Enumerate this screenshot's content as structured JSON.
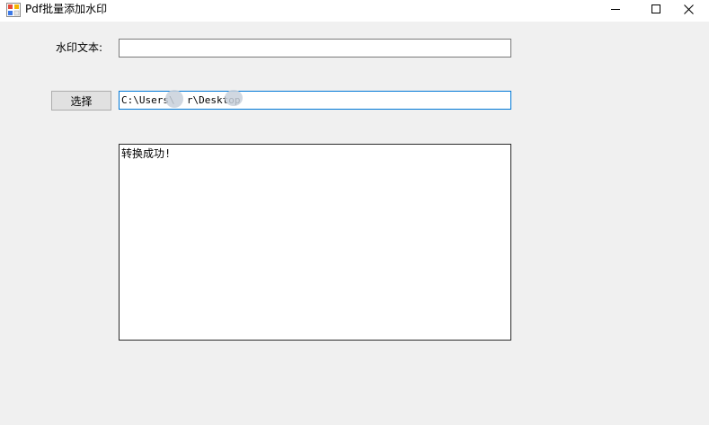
{
  "window": {
    "title": "Pdf批量添加水印",
    "controls": {
      "minimize_icon": "minimize-icon",
      "maximize_icon": "maximize-icon",
      "close_icon": "close-icon"
    }
  },
  "form": {
    "watermark_label": "水印文本:",
    "watermark_value": "",
    "select_button_label": "选择",
    "path_value": "C:\\Users\\  r\\Desktop",
    "output_text": "转换成功!"
  },
  "colors": {
    "window_bg": "#f0f0f0",
    "focus_border": "#0078d7",
    "button_bg": "#e1e1e1"
  }
}
